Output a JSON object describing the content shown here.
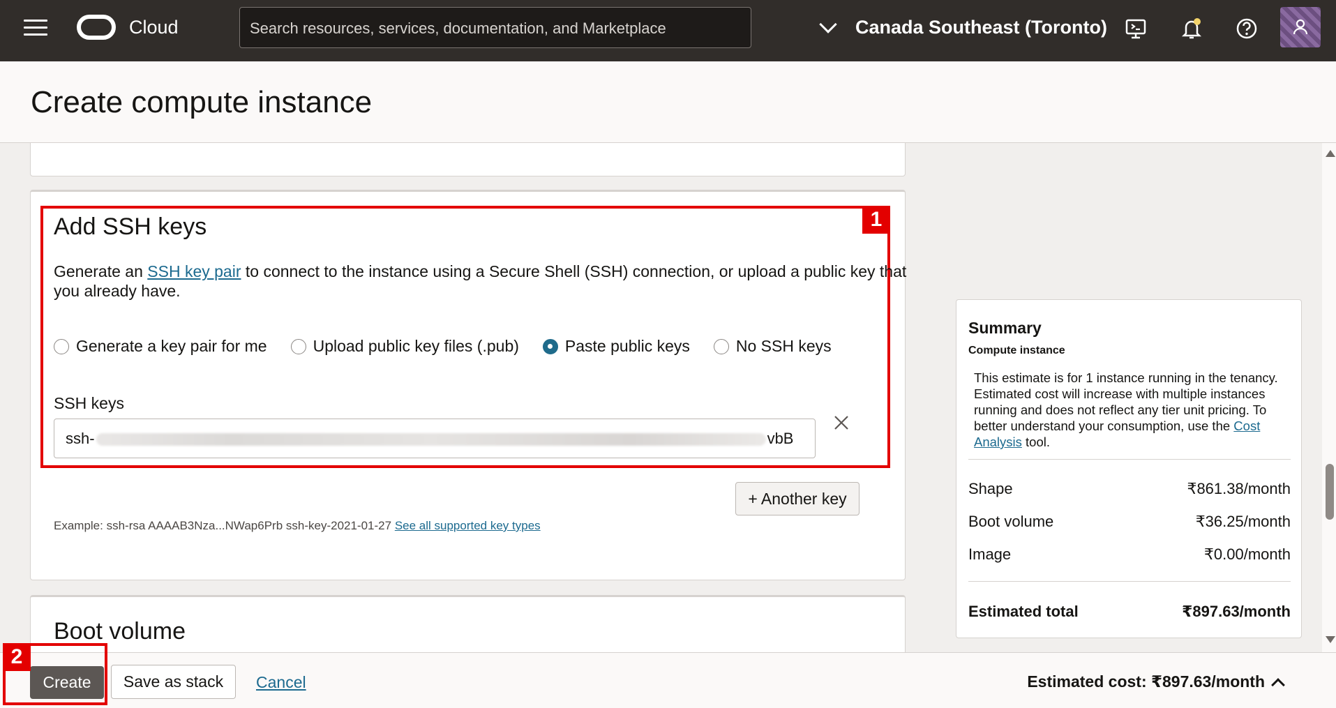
{
  "topbar": {
    "brand": "Cloud",
    "search_placeholder": "Search resources, services, documentation, and Marketplace",
    "region": "Canada Southeast (Toronto)",
    "icons": [
      "menu-icon",
      "oracle-logo",
      "chevron-down-icon",
      "cloud-shell-icon",
      "bell-icon",
      "help-icon",
      "profile-icon"
    ]
  },
  "page": {
    "title": "Create compute instance"
  },
  "ssh": {
    "title": "Add SSH keys",
    "desc_before": "Generate an ",
    "desc_link": "SSH key pair",
    "desc_after": " to connect to the instance using a Secure Shell (SSH) connection, or upload a public key that you already have.",
    "options": [
      {
        "label": "Generate a key pair for me",
        "selected": false
      },
      {
        "label": "Upload public key files (.pub)",
        "selected": false
      },
      {
        "label": "Paste public keys",
        "selected": true
      },
      {
        "label": "No SSH keys",
        "selected": false
      }
    ],
    "field_label": "SSH keys",
    "key_prefix": "ssh-",
    "key_suffix": "vbB",
    "another_key": "+ Another key",
    "example_text": "Example: ssh-rsa AAAAB3Nza...NWap6Prb ssh-key-2021-01-27",
    "example_link": "See all supported key types"
  },
  "boot": {
    "title": "Boot volume"
  },
  "summary": {
    "title": "Summary",
    "subtitle": "Compute instance",
    "desc_before": "This estimate is for 1 instance running in the tenancy. Estimated cost will increase with multiple instances running and does not reflect any tier unit pricing. To better understand your consumption, use the ",
    "desc_link": "Cost Analysis",
    "desc_after": " tool.",
    "rows": [
      {
        "label": "Shape",
        "value": "₹861.38/month"
      },
      {
        "label": "Boot volume",
        "value": "₹36.25/month"
      },
      {
        "label": "Image",
        "value": "₹0.00/month"
      }
    ],
    "total_label": "Estimated total",
    "total_value": "₹897.63/month"
  },
  "footer": {
    "create": "Create",
    "save_stack": "Save as stack",
    "cancel": "Cancel",
    "est_cost": "Estimated cost: ₹897.63/month"
  },
  "annotations": {
    "badge1": "1",
    "badge2": "2"
  },
  "colors": {
    "topbar": "#312d2a",
    "accent_red": "#e30000",
    "link": "#1c6a8f",
    "primary_button": "#5c5754"
  }
}
